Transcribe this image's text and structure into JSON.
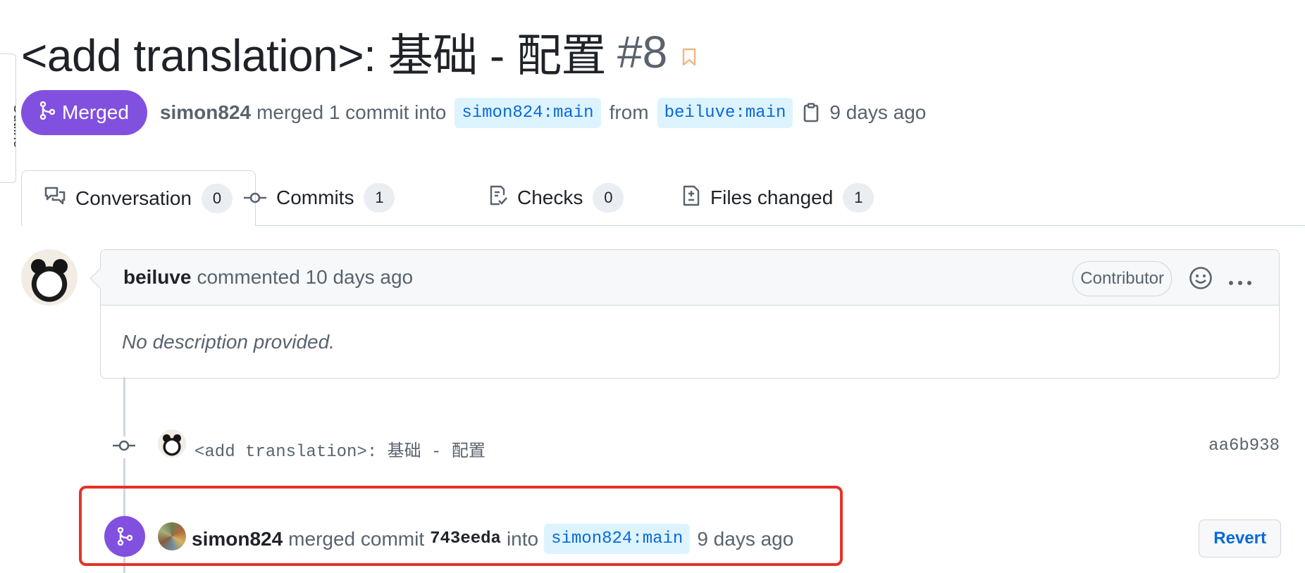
{
  "side_tab": {
    "label": "Outline"
  },
  "pr": {
    "title": "<add translation>: 基础 - 配置",
    "number": "#8",
    "state": "Merged",
    "merger": "simon824",
    "merged_text": "merged 1 commit into",
    "base_branch": "simon824:main",
    "from_text": "from",
    "head_branch": "beiluve:main",
    "merged_time": "9 days ago"
  },
  "tabs": [
    {
      "label": "Conversation",
      "count": "0",
      "icon": "comment-discussion-icon",
      "selected": true
    },
    {
      "label": "Commits",
      "count": "1",
      "icon": "git-commit-icon",
      "selected": false
    },
    {
      "label": "Checks",
      "count": "0",
      "icon": "checklist-icon",
      "selected": false
    },
    {
      "label": "Files changed",
      "count": "1",
      "icon": "file-diff-icon",
      "selected": false
    }
  ],
  "comment": {
    "author": "beiluve",
    "action": "commented 10 days ago",
    "role": "Contributor",
    "body": "No description provided."
  },
  "commit": {
    "message": "<add translation>: 基础 - 配置",
    "sha": "aa6b938"
  },
  "merge_event": {
    "author": "simon824",
    "text1": "merged commit",
    "sha": "743eeda",
    "text2": "into",
    "branch": "simon824:main",
    "time": "9 days ago",
    "revert_label": "Revert"
  },
  "colors": {
    "merged_purple": "#8250df",
    "link_blue": "#0969da",
    "highlight_red": "#e53327"
  }
}
